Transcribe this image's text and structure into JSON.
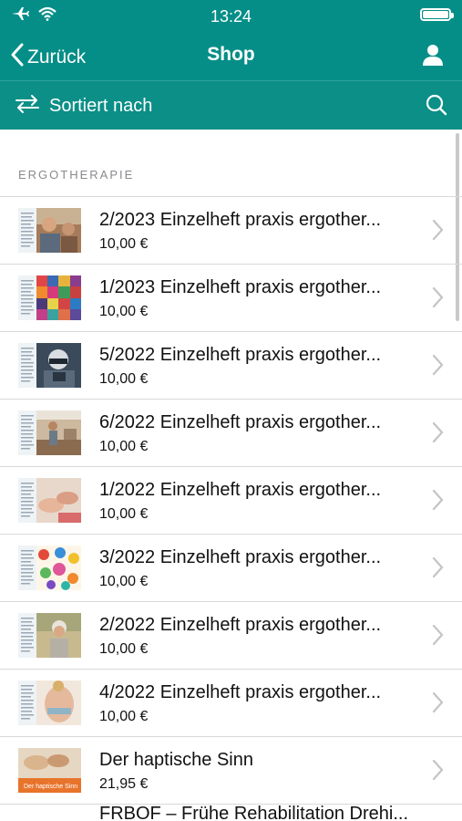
{
  "status_bar": {
    "time": "13:24"
  },
  "nav": {
    "back_label": "Zurück",
    "title": "Shop"
  },
  "sort": {
    "label": "Sortiert nach"
  },
  "section": {
    "header": "ERGOTHERAPIE"
  },
  "items": [
    {
      "title": "2/2023 Einzelheft praxis ergother...",
      "price": "10,00 €",
      "thumb": "people"
    },
    {
      "title": "1/2023 Einzelheft praxis ergother...",
      "price": "10,00 €",
      "thumb": "grid"
    },
    {
      "title": "5/2022 Einzelheft praxis ergother...",
      "price": "10,00 €",
      "thumb": "dark"
    },
    {
      "title": "6/2022 Einzelheft praxis ergother...",
      "price": "10,00 €",
      "thumb": "room"
    },
    {
      "title": "1/2022 Einzelheft praxis ergother...",
      "price": "10,00 €",
      "thumb": "hands"
    },
    {
      "title": "3/2022 Einzelheft praxis ergother...",
      "price": "10,00 €",
      "thumb": "colorhands"
    },
    {
      "title": "2/2022 Einzelheft praxis ergother...",
      "price": "10,00 €",
      "thumb": "woman"
    },
    {
      "title": "4/2022 Einzelheft praxis ergother...",
      "price": "10,00 €",
      "thumb": "back"
    },
    {
      "title": "Der haptische Sinn",
      "price": "21,95 €",
      "thumb": "book"
    }
  ],
  "partial_item": {
    "title": "FRBOF – Frühe Rehabilitation Drehi..."
  },
  "book_cover_text": "Der haptische Sinn"
}
